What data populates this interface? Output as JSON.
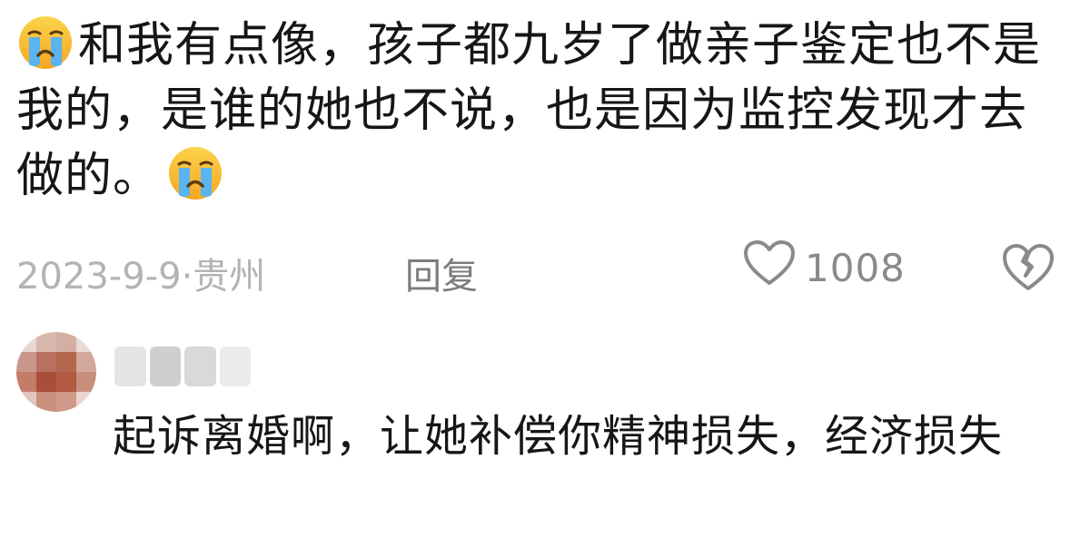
{
  "comment": {
    "emoji_icon": "loudly-crying-face-icon",
    "text": "和我有点像，孩子都九岁了做亲子鉴定也不是我的，是谁的她也不说，也是因为监控发现才去做的。",
    "date": "2023-9-9",
    "separator": "·",
    "location": "贵州",
    "reply_label": "回复",
    "like_count": "1008",
    "like_icon": "heart-outline-icon",
    "dislike_icon": "broken-heart-icon"
  },
  "reply": {
    "avatar_icon": "blurred-avatar",
    "username_icon": "blurred-username",
    "text": "起诉离婚啊，让她补偿你精神损失，经济损失"
  },
  "colors": {
    "text": "#161616",
    "meta": "#b3b3b3",
    "reply_label": "#7c7c7c",
    "like": "#8a8a8a"
  }
}
